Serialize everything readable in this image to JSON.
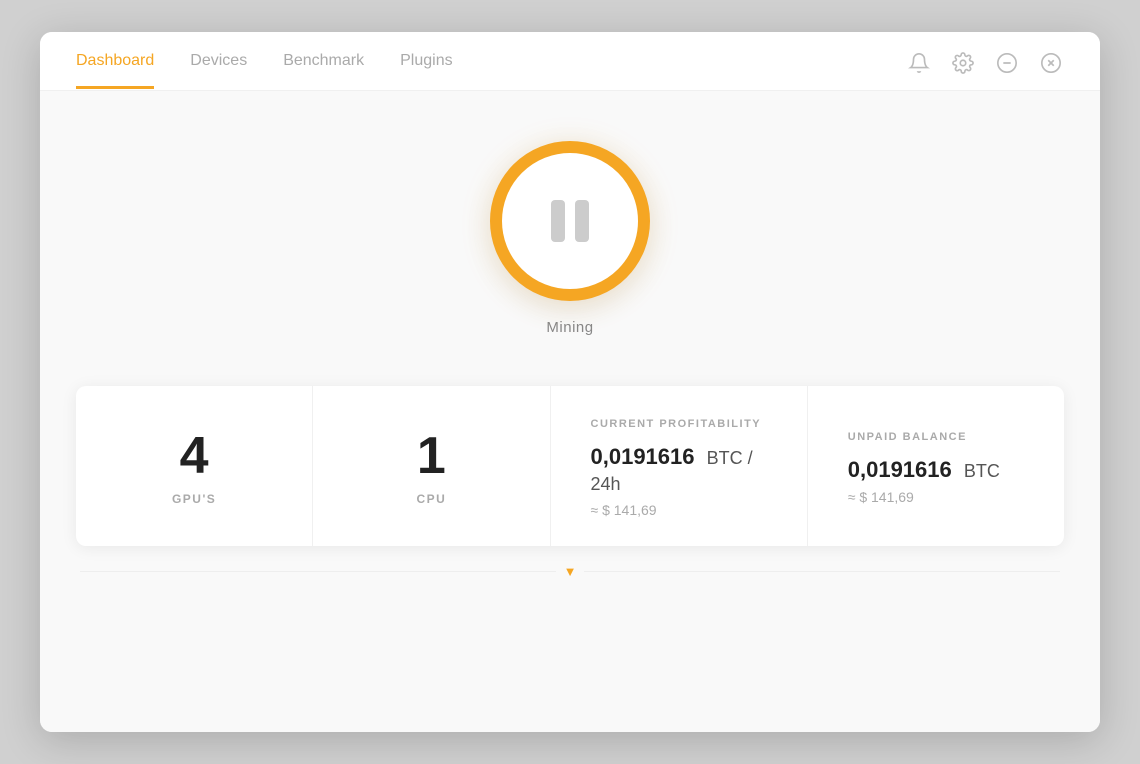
{
  "nav": {
    "tabs": [
      {
        "id": "dashboard",
        "label": "Dashboard",
        "active": true
      },
      {
        "id": "devices",
        "label": "Devices",
        "active": false
      },
      {
        "id": "benchmark",
        "label": "Benchmark",
        "active": false
      },
      {
        "id": "plugins",
        "label": "Plugins",
        "active": false
      }
    ],
    "icons": {
      "bell": "bell-icon",
      "settings": "settings-icon",
      "minimize": "minimize-icon",
      "close": "close-icon"
    }
  },
  "mining": {
    "status_label": "Mining",
    "button_state": "paused"
  },
  "stats": {
    "gpus": {
      "value": "4",
      "label": "GPU'S"
    },
    "cpu": {
      "value": "1",
      "label": "CPU"
    },
    "profitability": {
      "section_label": "CURRENT PROFITABILITY",
      "btc_value": "0,0191616",
      "btc_unit": "BTC / 24h",
      "usd_value": "≈ $ 141,69"
    },
    "balance": {
      "section_label": "UNPAID BALANCE",
      "btc_value": "0,0191616",
      "btc_unit": "BTC",
      "usd_value": "≈ $ 141,69"
    }
  },
  "colors": {
    "accent": "#f5a623",
    "text_primary": "#222",
    "text_secondary": "#aaa"
  }
}
